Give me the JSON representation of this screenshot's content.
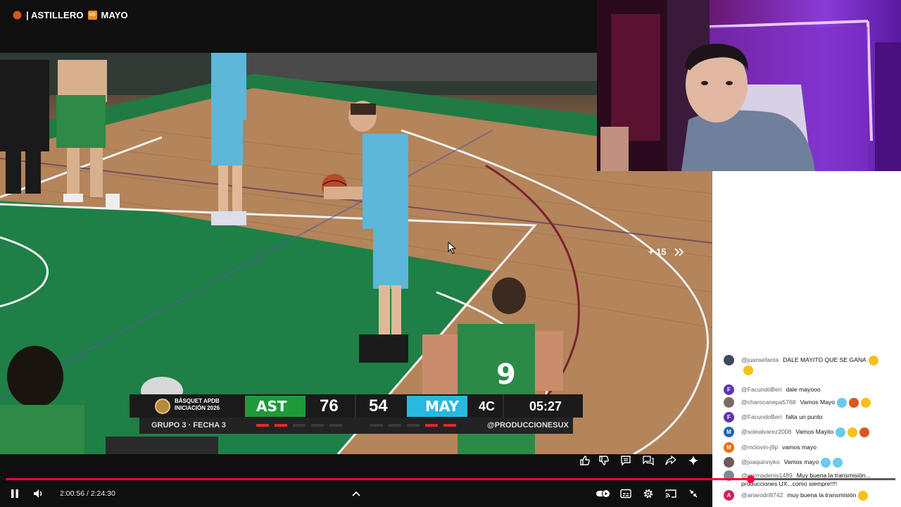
{
  "stream": {
    "title": "| ASTILLERO",
    "title_vs_badge": "VS",
    "title_team2": "MAYO"
  },
  "scoreboard": {
    "league": [
      "BÁSQUET APDB",
      "INICIACIÓN 2026"
    ],
    "home_team": "AST",
    "home_score": "76",
    "away_score": "54",
    "away_team": "MAY",
    "period": "4C",
    "clock": "05:27",
    "group": "GRUPO 3 · FECHA 3",
    "handle": "@PRODUCCIONESUX",
    "home_fouls": [
      1,
      1,
      0,
      0,
      0
    ],
    "away_fouls": [
      0,
      0,
      0,
      1,
      1
    ],
    "home_color": "#1f9a3a",
    "away_color": "#29b8e0"
  },
  "jersey_number": "9",
  "skip_label": "+ 15",
  "player": {
    "current_time": "2:00:56",
    "duration": "2:24:30",
    "time_label": "2:00:56 / 2:24:30",
    "progress_fraction": 0.8372,
    "accent": "#ff0033"
  },
  "chat": {
    "messages": [
      {
        "author": "@juansefanta",
        "text": "DALE MAYITO QUE SE GANA",
        "avatar_color": "#3b4a5c",
        "initial": "",
        "emojis": [
          "flexed-biceps",
          "raising-hands"
        ]
      },
      {
        "author": "@FacundoBeri",
        "text": "dale mayooo",
        "avatar_color": "#5e35b1",
        "initial": "F",
        "emojis": []
      },
      {
        "author": "@charocanepa5768",
        "text": "Vamos Mayo",
        "avatar_color": "#7a6a66",
        "initial": "",
        "emojis": [
          "light-blue-heart",
          "basketball",
          "flexed-biceps"
        ]
      },
      {
        "author": "@FacundoBeri",
        "text": "falta un punto",
        "avatar_color": "#5e35b1",
        "initial": "F",
        "emojis": []
      },
      {
        "author": "@solealvarez2008",
        "text": "Vamos Mayito",
        "avatar_color": "#1e63b8",
        "initial": "M",
        "emojis": [
          "light-blue-heart",
          "flexed-biceps",
          "basketball"
        ]
      },
      {
        "author": "@mclovin-j9p",
        "text": "vamos mayo",
        "avatar_color": "#ef6c00",
        "initial": "M",
        "emojis": []
      },
      {
        "author": "@joaquinnyko",
        "text": "Vamos mayo",
        "avatar_color": "#6b5a55",
        "initial": "",
        "emojis": [
          "light-blue-heart",
          "light-blue-heart"
        ]
      },
      {
        "author": "@normadenis1489",
        "text": "Muy buena la transmisión... producciones UX...como siempre!!!!",
        "avatar_color": "#7d8a96",
        "initial": "",
        "emojis": []
      },
      {
        "author": "@anarodri8742",
        "text": "muy buena la transmisión",
        "avatar_color": "#d81b60",
        "initial": "A",
        "emojis": [
          "smiling-face"
        ]
      }
    ]
  },
  "icons": {
    "like": "thumbs-up-icon",
    "dislike": "thumbs-down-icon",
    "comments": "comment-icon",
    "live_chat": "chat-bubbles-icon",
    "share": "share-icon",
    "ask": "sparkle-icon",
    "pause": "pause-icon",
    "volume": "volume-icon",
    "chapters": "chevron-up-icon",
    "autoplay": "autoplay-toggle-icon",
    "captions": "captions-icon",
    "settings": "gear-icon",
    "cast": "cast-icon",
    "fullscreen_exit": "exit-fullscreen-icon"
  }
}
